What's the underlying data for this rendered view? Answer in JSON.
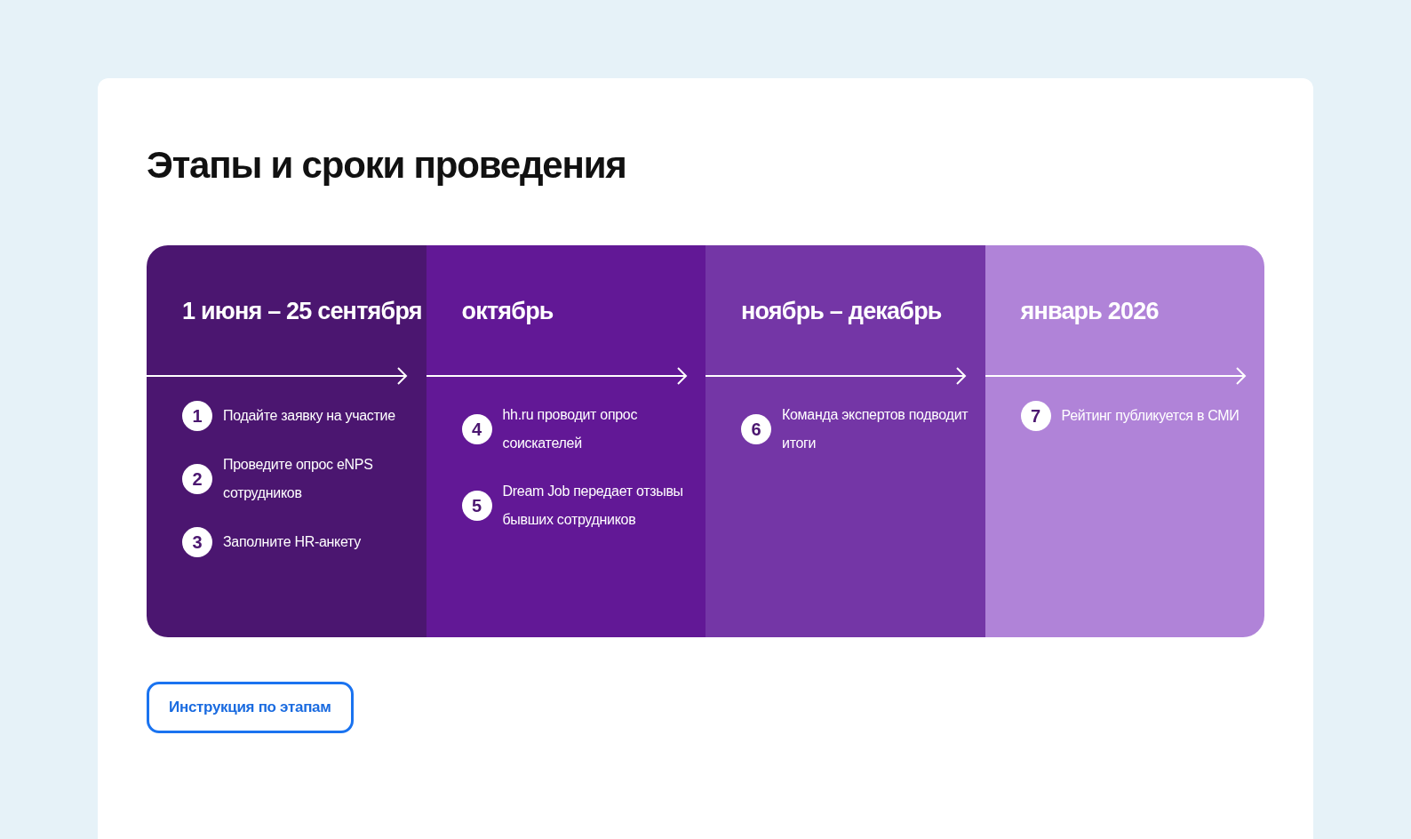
{
  "title": "Этапы и сроки проведения",
  "stages": [
    {
      "period": "1 июня – 25 сентября",
      "color": "#4b1670",
      "steps": [
        {
          "number": "1",
          "text": "Подайте заявку на участие"
        },
        {
          "number": "2",
          "text": "Проведите опрос eNPS сотрудников"
        },
        {
          "number": "3",
          "text": "Заполните HR-анкету"
        }
      ]
    },
    {
      "period": "октябрь",
      "color": "#621896",
      "steps": [
        {
          "number": "4",
          "text": "hh.ru проводит опрос соискателей"
        },
        {
          "number": "5",
          "text": "Dream Job передает отзывы бывших сотрудников"
        }
      ]
    },
    {
      "period": "ноябрь – декабрь",
      "color": "#7436a6",
      "steps": [
        {
          "number": "6",
          "text": "Команда экспертов подводит итоги"
        }
      ]
    },
    {
      "period": "январь 2026",
      "color": "#b083d8",
      "steps": [
        {
          "number": "7",
          "text": "Рейтинг публикуется в СМИ"
        }
      ]
    }
  ],
  "button": {
    "label": "Инструкция по этапам"
  }
}
